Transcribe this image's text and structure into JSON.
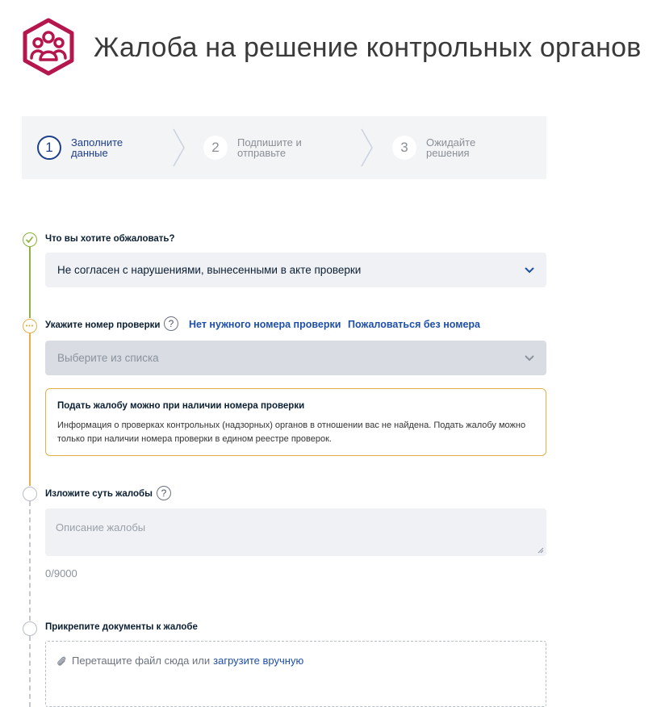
{
  "header": {
    "title": "Жалоба на решение контрольных органов",
    "logo_icon": "people-group-icon",
    "logo_color": "#b5174d"
  },
  "stepper": {
    "steps": [
      {
        "number": "1",
        "label": "Заполните данные",
        "active": true
      },
      {
        "number": "2",
        "label": "Подпишите и отправьте",
        "active": false
      },
      {
        "number": "3",
        "label": "Ожидайте решения",
        "active": false
      }
    ]
  },
  "form": {
    "q1": {
      "label": "Что вы хотите обжаловать?",
      "value": "Не согласен с нарушениями, вынесенными в акте проверки",
      "status": "done"
    },
    "q2": {
      "label": "Укажите номер проверки",
      "help": "?",
      "link_no_number": "Нет нужного номера проверки",
      "link_without_number": "Пожаловаться без номера",
      "placeholder": "Выберите из списка",
      "status": "in-progress",
      "notice": {
        "title": "Подать жалобу можно при наличии номера проверки",
        "text": "Информация о проверках контрольных (надзорных) органов в отношении вас не найдена. Подать жалобу можно только при наличии номера проверки в едином реестре проверок."
      }
    },
    "q3": {
      "label": "Изложите суть жалобы",
      "help": "?",
      "placeholder": "Описание жалобы",
      "counter": "0/9000",
      "status": "pending"
    },
    "q4": {
      "label": "Прикрепите документы к жалобе",
      "drop_text": "Перетащите файл сюда или",
      "upload_link": "загрузите вручную",
      "status": "pending"
    }
  },
  "colors": {
    "accent": "#1e4fa8",
    "done": "#8bb23a",
    "in_progress": "#e3b14b",
    "pending": "#b8bec6"
  }
}
